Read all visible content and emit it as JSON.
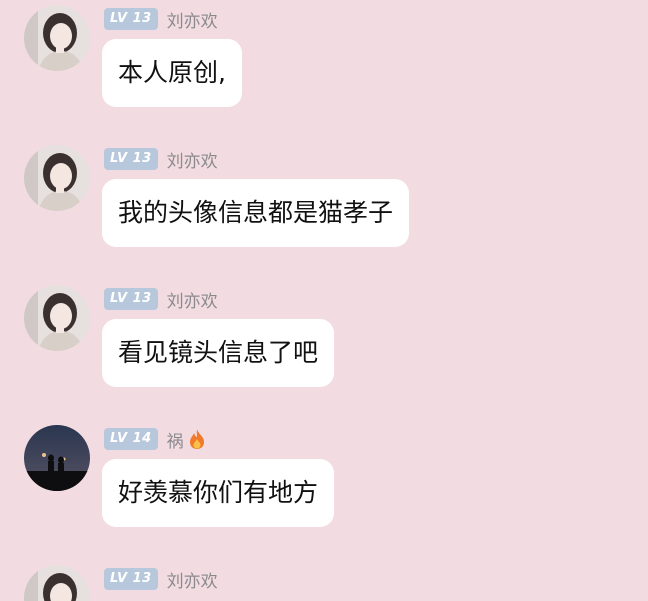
{
  "messages": [
    {
      "level": "LV 13",
      "name": "刘亦欢",
      "text": "本人原创,",
      "avatar": "girl-portrait"
    },
    {
      "level": "LV 13",
      "name": "刘亦欢",
      "text": "我的头像信息都是猫孝子",
      "avatar": "girl-portrait"
    },
    {
      "level": "LV 13",
      "name": "刘亦欢",
      "text": "看见镜头信息了吧",
      "avatar": "girl-portrait"
    },
    {
      "level": "LV 14",
      "name": "祸",
      "text": "好羡慕你们有地方",
      "avatar": "night-couple-silhouette",
      "badge_icon": "flame-icon"
    },
    {
      "level": "LV 13",
      "name": "刘亦欢",
      "text": "",
      "avatar": "girl-portrait"
    }
  ],
  "colors": {
    "background": "#f3dce1",
    "bubble": "#ffffff",
    "level_badge": "#b8c8dc",
    "name_text": "#8a8a8e",
    "flame": "#f07a2a"
  }
}
